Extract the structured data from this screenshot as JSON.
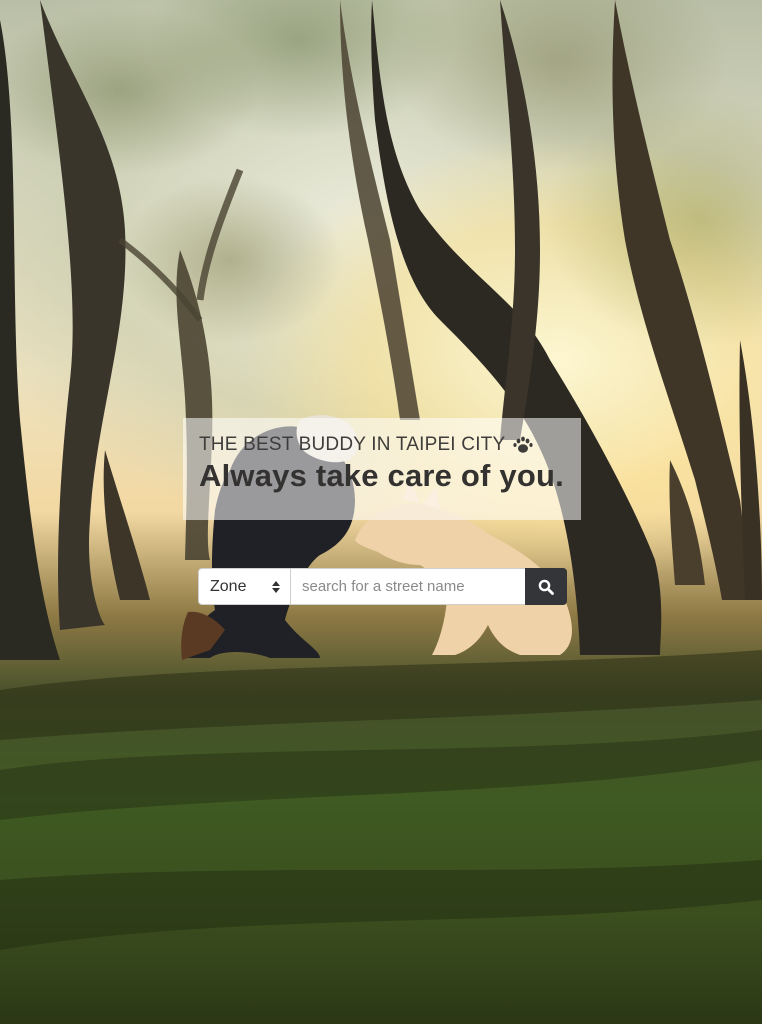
{
  "hero": {
    "kicker": "THE BEST BUDDY IN TAIPEI CITY",
    "kicker_icon": "paw-icon",
    "title": "Always take care of you."
  },
  "search": {
    "zone_label": "Zone",
    "zone_icon": "select-arrows-icon",
    "input_placeholder": "search for a street name",
    "input_value": "",
    "button_icon": "search-icon"
  },
  "colors": {
    "search_button_bg": "#333539",
    "headline_text": "#333230",
    "overlay_box": "rgba(255,255,255,0.55)"
  }
}
